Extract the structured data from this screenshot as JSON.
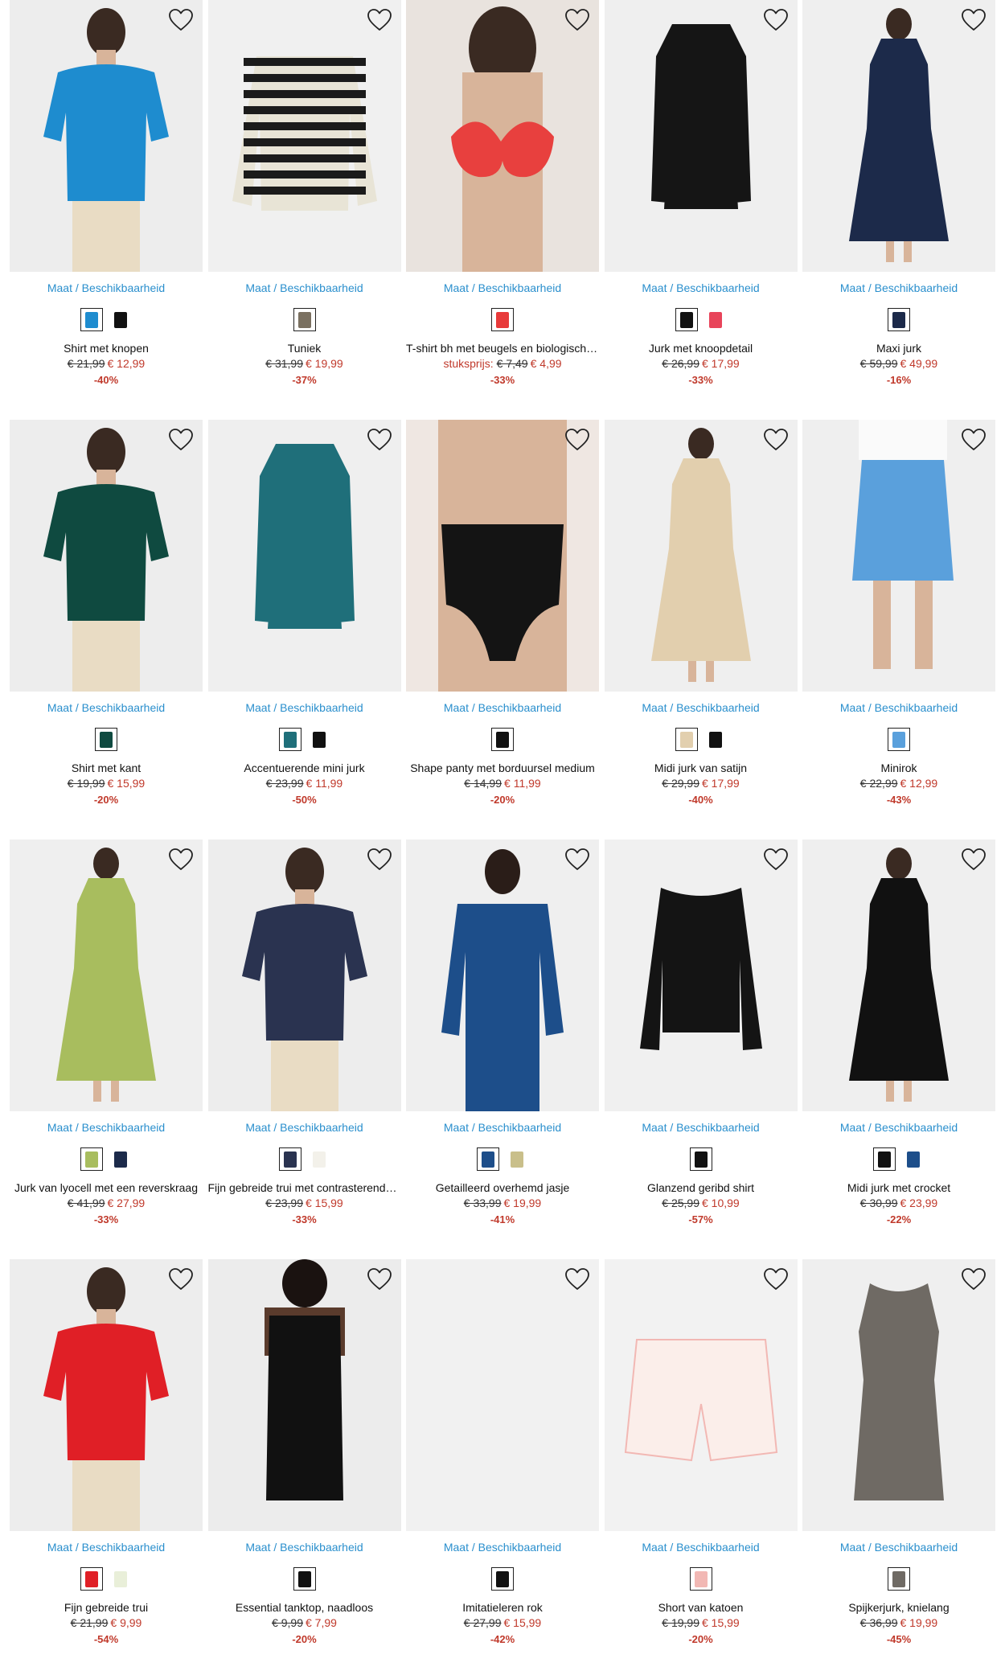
{
  "size_link_label": "Maat / Beschikbaarheid",
  "wishlist_icon": "heart-outline-icon",
  "colors": {
    "link": "#2a8fcd",
    "sale": "#c0392b",
    "image_bg": "#efefef"
  },
  "products": [
    {
      "name": "Shirt met knopen",
      "old_price": "€ 21,99",
      "new_price": "€ 12,99",
      "discount": "-40%",
      "swatches": [
        "#1e8ccf",
        "#111111"
      ],
      "art": {
        "type": "top",
        "color": "#1e8ccf"
      }
    },
    {
      "name": "Tuniek",
      "old_price": "€ 31,99",
      "new_price": "€ 19,99",
      "discount": "-37%",
      "swatches": [
        "#7a7060"
      ],
      "art": {
        "type": "stripes",
        "color": "#1b1b1b"
      }
    },
    {
      "name": "T-shirt bh met beugels en biologisch katoen",
      "price_prefix": "stuksprijs:",
      "old_price": "€ 7,49",
      "new_price": "€ 4,99",
      "discount": "-33%",
      "swatches": [
        "#e83a3a"
      ],
      "art": {
        "type": "bra",
        "color": "#e8403e"
      }
    },
    {
      "name": "Jurk met knoopdetail",
      "old_price": "€ 26,99",
      "new_price": "€ 17,99",
      "discount": "-33%",
      "swatches": [
        "#111111",
        "#e8445a"
      ],
      "art": {
        "type": "dress",
        "color": "#151515"
      }
    },
    {
      "name": "Maxi jurk",
      "old_price": "€ 59,99",
      "new_price": "€ 49,99",
      "discount": "-16%",
      "swatches": [
        "#1c2a4a"
      ],
      "art": {
        "type": "maxi",
        "color": "#1c2a4a"
      }
    },
    {
      "name": "Shirt met kant",
      "old_price": "€ 19,99",
      "new_price": "€ 15,99",
      "discount": "-20%",
      "swatches": [
        "#0f4a40"
      ],
      "art": {
        "type": "top",
        "color": "#0f4a40"
      }
    },
    {
      "name": "Accentuerende mini jurk",
      "old_price": "€ 23,99",
      "new_price": "€ 11,99",
      "discount": "-50%",
      "swatches": [
        "#1f6f7a",
        "#111111"
      ],
      "art": {
        "type": "dress",
        "color": "#1f6f7a"
      }
    },
    {
      "name": "Shape panty met borduursel medium",
      "old_price": "€ 14,99",
      "new_price": "€ 11,99",
      "discount": "-20%",
      "swatches": [
        "#111111"
      ],
      "art": {
        "type": "panty",
        "color": "#141414"
      }
    },
    {
      "name": "Midi jurk van satijn",
      "old_price": "€ 29,99",
      "new_price": "€ 17,99",
      "discount": "-40%",
      "swatches": [
        "#e2cfae",
        "#111111"
      ],
      "art": {
        "type": "maxi",
        "color": "#e2cfae"
      }
    },
    {
      "name": "Minirok",
      "old_price": "€ 22,99",
      "new_price": "€ 12,99",
      "discount": "-43%",
      "swatches": [
        "#5aa0dc"
      ],
      "art": {
        "type": "skirt",
        "color": "#5aa0dc"
      }
    },
    {
      "name": "Jurk van lyocell met een reverskraag",
      "old_price": "€ 41,99",
      "new_price": "€ 27,99",
      "discount": "-33%",
      "swatches": [
        "#a8bd5e",
        "#1c2a4a"
      ],
      "art": {
        "type": "maxi",
        "color": "#a8bd5e"
      }
    },
    {
      "name": "Fijn gebreide trui met contrasterende rand",
      "old_price": "€ 23,99",
      "new_price": "€ 15,99",
      "discount": "-33%",
      "swatches": [
        "#2a3350",
        "#f3f1ea"
      ],
      "art": {
        "type": "top",
        "color": "#2a3350"
      }
    },
    {
      "name": "Getailleerd overhemd jasje",
      "old_price": "€ 33,99",
      "new_price": "€ 19,99",
      "discount": "-41%",
      "swatches": [
        "#1d4e8a",
        "#c9bf8a"
      ],
      "art": {
        "type": "jacket",
        "color": "#1d4e8a"
      }
    },
    {
      "name": "Glanzend geribd shirt",
      "old_price": "€ 25,99",
      "new_price": "€ 10,99",
      "discount": "-57%",
      "swatches": [
        "#111111"
      ],
      "art": {
        "type": "longsleeve",
        "color": "#141414"
      }
    },
    {
      "name": "Midi jurk met crocket",
      "old_price": "€ 30,99",
      "new_price": "€ 23,99",
      "discount": "-22%",
      "swatches": [
        "#111111",
        "#1d4e8a"
      ],
      "art": {
        "type": "maxi",
        "color": "#111111"
      }
    },
    {
      "name": "Fijn gebreide trui",
      "old_price": "€ 21,99",
      "new_price": "€ 9,99",
      "discount": "-54%",
      "swatches": [
        "#e01f26",
        "#e9efd9"
      ],
      "art": {
        "type": "top",
        "color": "#e01f26"
      }
    },
    {
      "name": "Essential tanktop, naadloos",
      "old_price": "€ 9,99",
      "new_price": "€ 7,99",
      "discount": "-20%",
      "swatches": [
        "#111111"
      ],
      "art": {
        "type": "tank",
        "color": "#111111"
      }
    },
    {
      "name": "Imitatieleren rok",
      "old_price": "€ 27,99",
      "new_price": "€ 15,99",
      "discount": "-42%",
      "swatches": [
        "#111111"
      ],
      "art": {
        "type": "blank",
        "color": "#f1f1f1"
      }
    },
    {
      "name": "Short van katoen",
      "old_price": "€ 19,99",
      "new_price": "€ 15,99",
      "discount": "-20%",
      "swatches": [
        "#f2b8b4"
      ],
      "art": {
        "type": "shorts",
        "color": "#f2b8b4"
      }
    },
    {
      "name": "Spijkerjurk, knielang",
      "old_price": "€ 36,99",
      "new_price": "€ 19,99",
      "discount": "-45%",
      "swatches": [
        "#6f6a64"
      ],
      "art": {
        "type": "sheath",
        "color": "#6f6a64"
      }
    }
  ]
}
